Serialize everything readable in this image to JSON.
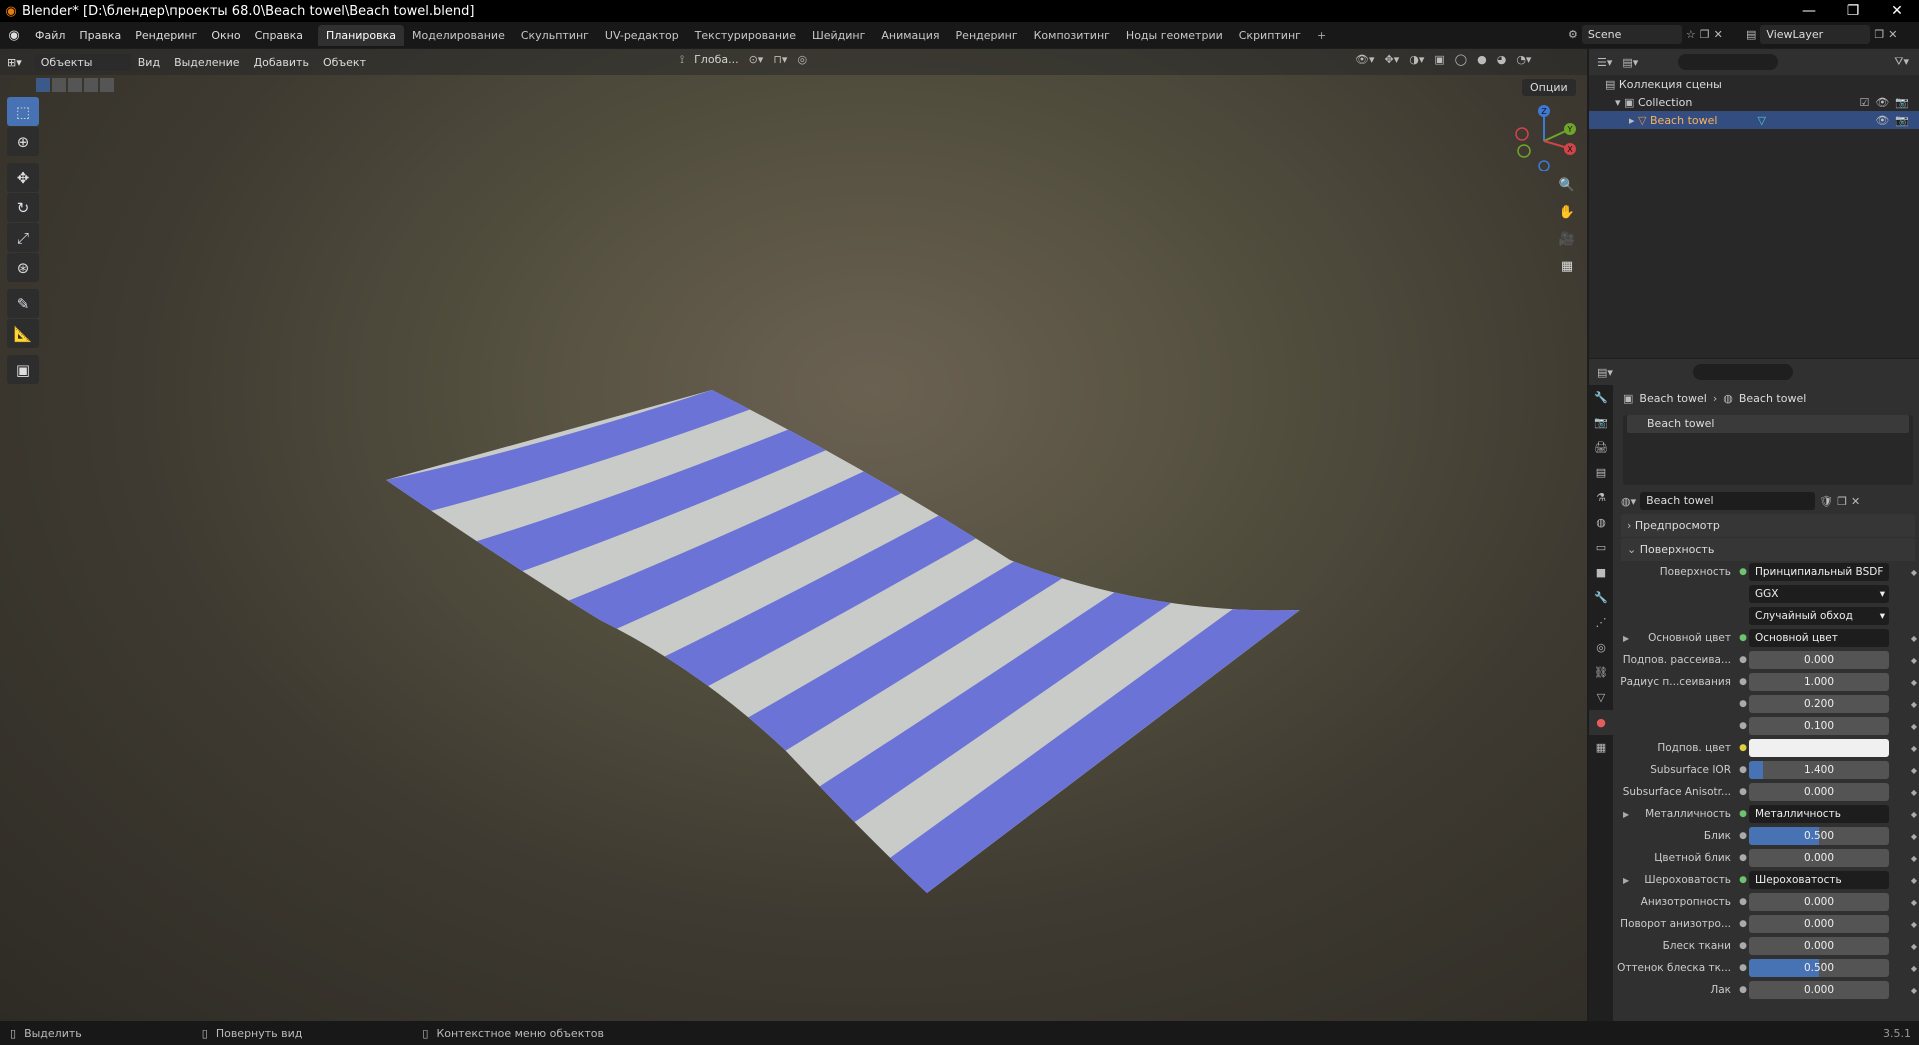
{
  "window": {
    "title": "Blender* [D:\\блендер\\проекты 68.0\\Beach towel\\Beach towel.blend]",
    "controls": [
      "—",
      "❐",
      "✕"
    ]
  },
  "menu": [
    "Файл",
    "Правка",
    "Рендеринг",
    "Окно",
    "Справка"
  ],
  "workspaces": [
    "Планировка",
    "Моделирование",
    "Скульптинг",
    "UV-редактор",
    "Текстурирование",
    "Шейдинг",
    "Анимация",
    "Рендеринг",
    "Композитинг",
    "Ноды геометрии",
    "Скриптинг",
    "+"
  ],
  "scene": "Scene",
  "view_layer": "ViewLayer",
  "viewport": {
    "mode": "Объекты",
    "menus": [
      "Вид",
      "Выделение",
      "Добавить",
      "Объект"
    ],
    "transform_orientation": "Глоба...",
    "options_label": "Опции",
    "gizmo_axes": [
      "Z",
      "Y",
      "X"
    ]
  },
  "outliner": {
    "root": "Коллекция сцены",
    "collection": "Collection",
    "object": "Beach towel"
  },
  "properties": {
    "breadcrumb": [
      "Beach towel",
      "Beach towel"
    ],
    "material_slot": "Beach towel",
    "material_name": "Beach towel",
    "panels": {
      "preview": "Предпросмотр",
      "surface": "Поверхность"
    },
    "rows": [
      {
        "label": "Поверхность",
        "value": "Принципиальный BSDF",
        "type": "link",
        "dot": "●"
      },
      {
        "label": "",
        "value": "GGX",
        "type": "select"
      },
      {
        "label": "",
        "value": "Случайный обход",
        "type": "select"
      },
      {
        "label": "Основной цвет",
        "value": "Основной цвет",
        "type": "link",
        "expand": true
      },
      {
        "label": "Подпов. рассеива...",
        "value": "0.000",
        "type": "num"
      },
      {
        "label": "Радиус п...сеивания",
        "value": "1.000",
        "type": "num"
      },
      {
        "label": "",
        "value": "0.200",
        "type": "num"
      },
      {
        "label": "",
        "value": "0.100",
        "type": "num"
      },
      {
        "label": "Подпов. цвет",
        "value": "",
        "type": "color"
      },
      {
        "label": "Subsurface IOR",
        "value": "1.400",
        "type": "num",
        "fill": 0.1
      },
      {
        "label": "Subsurface Anisotr...",
        "value": "0.000",
        "type": "num"
      },
      {
        "label": "Металличность",
        "value": "Металличность",
        "type": "link",
        "expand": true
      },
      {
        "label": "Блик",
        "value": "0.500",
        "type": "num",
        "fill": 0.5
      },
      {
        "label": "Цветной блик",
        "value": "0.000",
        "type": "num"
      },
      {
        "label": "Шероховатость",
        "value": "Шероховатость",
        "type": "link",
        "expand": true
      },
      {
        "label": "Анизотропность",
        "value": "0.000",
        "type": "num"
      },
      {
        "label": "Поворот анизотро...",
        "value": "0.000",
        "type": "num"
      },
      {
        "label": "Блеск ткани",
        "value": "0.000",
        "type": "num"
      },
      {
        "label": "Оттенок блеска тк...",
        "value": "0.500",
        "type": "num",
        "fill": 0.5
      },
      {
        "label": "Лак",
        "value": "0.000",
        "type": "num"
      }
    ]
  },
  "status": {
    "select": "Выделить",
    "rotate": "Повернуть вид",
    "context": "Контекстное меню объектов",
    "version": "3.5.1"
  },
  "colors": {
    "accent": "#4772b3",
    "towel_blue": "#6b74d6",
    "towel_white": "#c9cbc8"
  }
}
